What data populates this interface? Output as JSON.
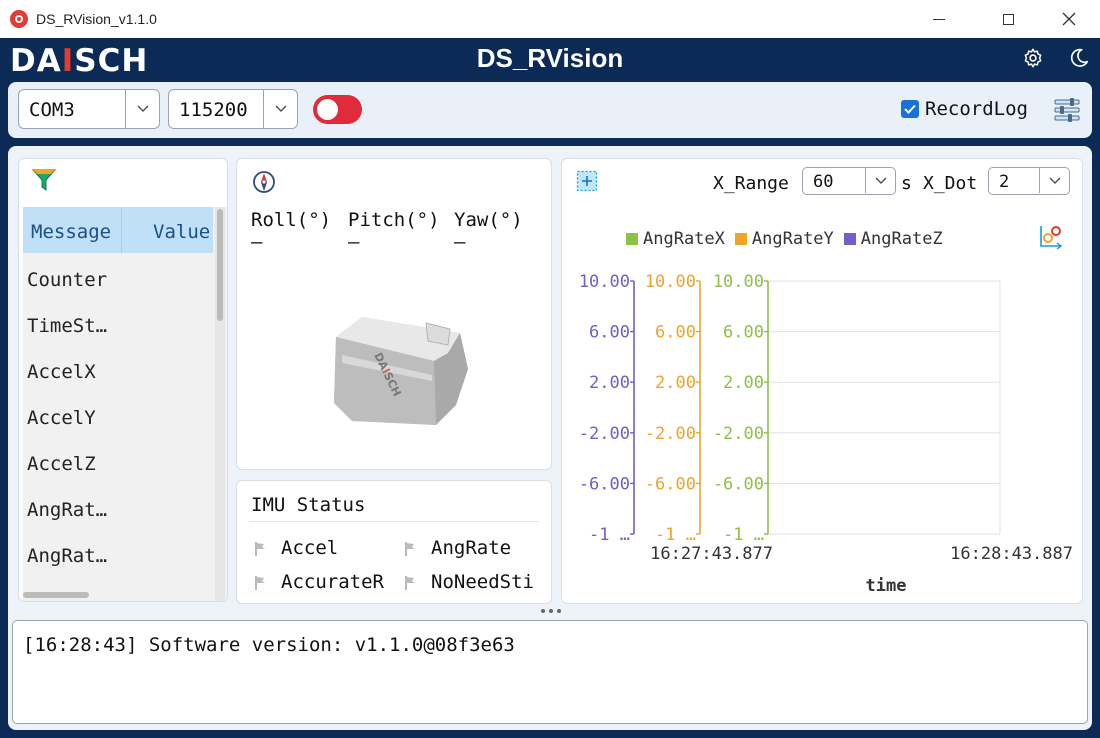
{
  "window": {
    "title": "DS_RVision_v1.1.0"
  },
  "header": {
    "logo_prefix": "DA",
    "logo_accent": "I",
    "logo_suffix": "SCH",
    "title": "DS_RVision"
  },
  "toolbar": {
    "port": "COM3",
    "baud": "115200",
    "connection_on": false,
    "record_log_label": "RecordLog",
    "record_log_checked": true
  },
  "message_table": {
    "headers": [
      "Message",
      "Value"
    ],
    "rows": [
      "Counter",
      "TimeSt…",
      "AccelX",
      "AccelY",
      "AccelZ",
      "AngRat…",
      "AngRat…"
    ]
  },
  "attitude": {
    "labels": [
      "Roll(°)",
      "Pitch(°)",
      "Yaw(°)"
    ],
    "values": [
      "–",
      "–",
      "–"
    ]
  },
  "imu_status": {
    "title": "IMU Status",
    "items": [
      "Accel",
      "AngRate",
      "AccurateR",
      "NoNeedSti"
    ]
  },
  "chart_controls": {
    "x_range_label": "X_Range",
    "x_range_value": "60",
    "x_range_unit": "s",
    "x_dot_label": "X_Dot",
    "x_dot_value": "2"
  },
  "colors": {
    "angratex": "#8fc04a",
    "angratey": "#f0a42c",
    "angratez": "#7060c8",
    "accent": "#0b2a55",
    "toggle": "#e02b3b"
  },
  "chart_data": {
    "type": "line",
    "legend_position": "top",
    "series": [
      {
        "name": "AngRateX",
        "values": []
      },
      {
        "name": "AngRateY",
        "values": []
      },
      {
        "name": "AngRateZ",
        "values": []
      }
    ],
    "y_ticks": [
      "10.00",
      "6.00",
      "2.00",
      "-2.00",
      "-6.00",
      "-1 …"
    ],
    "ylim": [
      -10,
      10
    ],
    "x_ticks": [
      "16:27:43.877",
      "16:28:43.887"
    ],
    "xlabel": "time",
    "grid": true
  },
  "log": {
    "lines": [
      "[16:28:43] Software version: v1.1.0@08f3e63"
    ]
  }
}
